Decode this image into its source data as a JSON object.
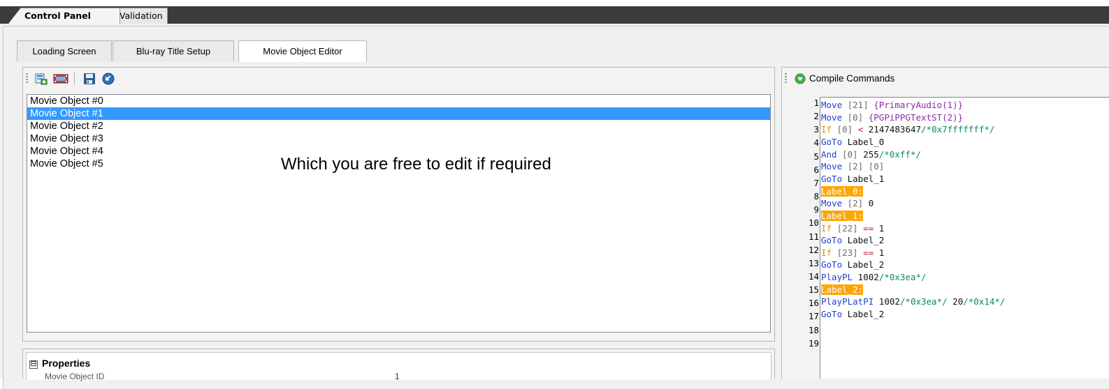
{
  "top_tabs": {
    "control_panel": "Control Panel",
    "validation": "Validation"
  },
  "sub_tabs": {
    "loading_screen": "Loading Screen",
    "bluray_title_setup": "Blu-ray Title Setup",
    "movie_object_editor": "Movie Object Editor"
  },
  "movie_objects": {
    "items": [
      {
        "label": "Movie Object #0"
      },
      {
        "label": "Movie Object #1"
      },
      {
        "label": "Movie Object #2"
      },
      {
        "label": "Movie Object #3"
      },
      {
        "label": "Movie Object #4"
      },
      {
        "label": "Movie Object #5"
      }
    ],
    "selected_index": 1
  },
  "annotation": "Which you are free to edit if required",
  "properties": {
    "header": "Properties",
    "toggle": "⊟",
    "rows": [
      {
        "name": "Movie Object ID",
        "value": "1"
      }
    ]
  },
  "compile": {
    "label": "Compile Commands"
  },
  "code": {
    "line_numbers": [
      "1",
      "2",
      "3",
      "4",
      "5",
      "6",
      "7",
      "8",
      "9",
      "10",
      "11",
      "12",
      "13",
      "14",
      "15",
      "16",
      "17",
      "18",
      "19"
    ],
    "lines": [
      [
        {
          "t": "Move",
          "c": "kw-blue"
        },
        {
          "t": " [21] ",
          "c": "c-gray"
        },
        {
          "t": "{PrimaryAudio(1)}",
          "c": "kw-purple"
        }
      ],
      [
        {
          "t": "Move",
          "c": "kw-blue"
        },
        {
          "t": " [0] ",
          "c": "c-gray"
        },
        {
          "t": "{PGPiPPGTextST(2)}",
          "c": "kw-purple"
        }
      ],
      [
        {
          "t": "If",
          "c": "kw-orange"
        },
        {
          "t": " [0] ",
          "c": "c-gray"
        },
        {
          "t": "< ",
          "c": "c-red"
        },
        {
          "t": "2147483647",
          "c": "c-black"
        },
        {
          "t": "/*0x7fffffff*/",
          "c": "c-green"
        }
      ],
      [
        {
          "t": "GoTo",
          "c": "kw-blue"
        },
        {
          "t": " Label_0",
          "c": "c-black"
        }
      ],
      [
        {
          "t": "And",
          "c": "kw-blue"
        },
        {
          "t": " [0] ",
          "c": "c-gray"
        },
        {
          "t": "255",
          "c": "c-black"
        },
        {
          "t": "/*0xff*/",
          "c": "c-green"
        }
      ],
      [
        {
          "t": "Move",
          "c": "kw-blue"
        },
        {
          "t": " [2] [0]",
          "c": "c-gray"
        }
      ],
      [
        {
          "t": "GoTo",
          "c": "kw-blue"
        },
        {
          "t": " Label_1",
          "c": "c-black"
        }
      ],
      [
        {
          "t": "Label_0:",
          "c": "label-hl"
        }
      ],
      [
        {
          "t": "Move",
          "c": "kw-blue"
        },
        {
          "t": " [2] ",
          "c": "c-gray"
        },
        {
          "t": "0",
          "c": "c-black"
        }
      ],
      [
        {
          "t": "Label_1:",
          "c": "label-hl"
        }
      ],
      [
        {
          "t": "If",
          "c": "kw-orange"
        },
        {
          "t": " [22] ",
          "c": "c-gray"
        },
        {
          "t": "== ",
          "c": "c-red"
        },
        {
          "t": "1",
          "c": "c-black"
        }
      ],
      [
        {
          "t": "GoTo",
          "c": "kw-blue"
        },
        {
          "t": " Label_2",
          "c": "c-black"
        }
      ],
      [
        {
          "t": "If",
          "c": "kw-orange"
        },
        {
          "t": " [23] ",
          "c": "c-gray"
        },
        {
          "t": "== ",
          "c": "c-red"
        },
        {
          "t": "1",
          "c": "c-black"
        }
      ],
      [
        {
          "t": "GoTo",
          "c": "kw-blue"
        },
        {
          "t": " Label_2",
          "c": "c-black"
        }
      ],
      [
        {
          "t": "PlayPL",
          "c": "kw-blue"
        },
        {
          "t": " 1002",
          "c": "c-black"
        },
        {
          "t": "/*0x3ea*/",
          "c": "c-green"
        }
      ],
      [
        {
          "t": "Label_2:",
          "c": "label-hl"
        }
      ],
      [
        {
          "t": "PlayPLatPI",
          "c": "kw-blue"
        },
        {
          "t": " 1002",
          "c": "c-black"
        },
        {
          "t": "/*0x3ea*/",
          "c": "c-green"
        },
        {
          "t": " 20",
          "c": "c-black"
        },
        {
          "t": "/*0x14*/",
          "c": "c-green"
        }
      ],
      [
        {
          "t": "GoTo",
          "c": "kw-blue"
        },
        {
          "t": " Label_2",
          "c": "c-black"
        }
      ]
    ]
  },
  "icons": [
    "add-movie-object-icon",
    "film-icon",
    "save-icon",
    "import-icon",
    "compile-icon"
  ],
  "colors": {
    "selection": "#3399ff",
    "label_highlight": "#ffa500",
    "topbar": "#3c3c3c"
  }
}
